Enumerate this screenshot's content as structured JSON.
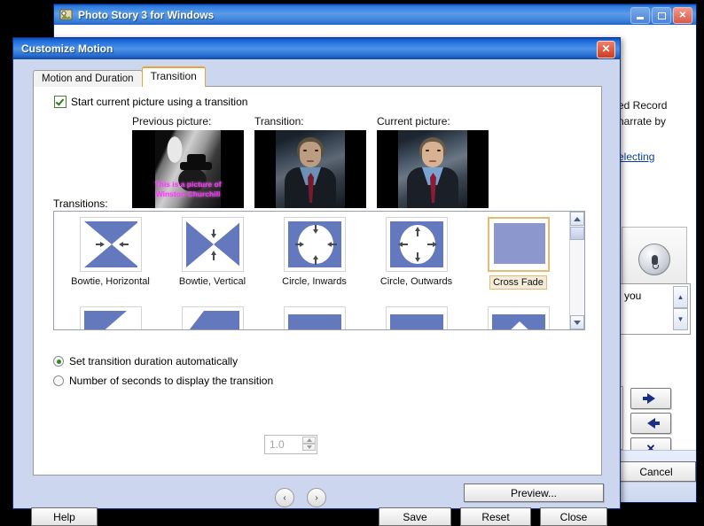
{
  "app_window": {
    "title": "Photo Story 3 for Windows",
    "icon": "photo-story-icon",
    "minimize_label": "_",
    "maximize_label": "□",
    "close_label": "✕",
    "body_text_1": "ed Record",
    "body_text_2": "narrate by",
    "link_text": "electing",
    "mic_icon": "microphone-icon",
    "narration_value": "you",
    "spin_up": "▲",
    "spin_down": "▼",
    "move_right_icon": "arrow-right-icon",
    "move_left_icon": "arrow-left-icon",
    "delete_icon": "x-icon",
    "side_tab_label": ">",
    "cancel_label": "Cancel"
  },
  "dialog": {
    "title": "Customize Motion",
    "close_label": "✕",
    "tabs": [
      {
        "label": "Motion and Duration",
        "active": false
      },
      {
        "label": "Transition",
        "active": true
      }
    ],
    "checkbox": {
      "label": "Start current picture using a transition",
      "checked": true
    },
    "previews": [
      {
        "caption": "Previous picture:",
        "overlay_line1": "This is a picture of",
        "overlay_line2": "Winston Churchill"
      },
      {
        "caption": "Transition:",
        "overlay_line1": "",
        "overlay_line2": ""
      },
      {
        "caption": "Current picture:",
        "overlay_line1": "",
        "overlay_line2": ""
      }
    ],
    "transitions_label": "Transitions:",
    "transitions": [
      {
        "name": "Bowtie, Horizontal",
        "art": "bowtie-h",
        "selected": false
      },
      {
        "name": "Bowtie, Vertical",
        "art": "bowtie-v",
        "selected": false
      },
      {
        "name": "Circle, Inwards",
        "art": "circle-in",
        "selected": false
      },
      {
        "name": "Circle, Outwards",
        "art": "circle-out",
        "selected": false
      },
      {
        "name": "Cross Fade",
        "art": "cross-fade",
        "selected": true
      }
    ],
    "transitions_row2": [
      {
        "art": "diagonal-1"
      },
      {
        "art": "diagonal-2"
      },
      {
        "art": "bar-1"
      },
      {
        "art": "bar-2"
      },
      {
        "art": "peak-1"
      }
    ],
    "scroll_up": "▲",
    "scroll_down": "▼",
    "duration": {
      "auto_label": "Set transition duration automatically",
      "auto_selected": true,
      "manual_label": "Number of seconds to display the transition",
      "manual_selected": false,
      "seconds_value": "1.0",
      "spin_up": "▲",
      "spin_down": "▼"
    },
    "nav_prev_icon": "chevron-left-icon",
    "nav_next_icon": "chevron-right-icon",
    "buttons": {
      "help": "Help",
      "preview": "Preview...",
      "save": "Save",
      "reset": "Reset",
      "close": "Close"
    }
  },
  "colors": {
    "accent_blue": "#6478bd",
    "titlebar_blue": "#1e6ddc",
    "dialog_bg": "#cdd6ef",
    "selection_gold": "#e3bb74",
    "overlay_magenta": "#f13df1"
  }
}
